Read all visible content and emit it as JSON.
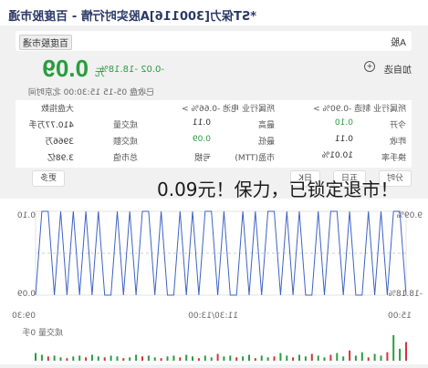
{
  "title": "*ST保力[300116]A股实时行情 - 百度股市通",
  "tabs": {
    "left": "A股",
    "right": "百度股市通"
  },
  "quote": {
    "price": "0.09",
    "unit": "元",
    "change": "-0.02 -18.18%",
    "status": "已收盘  05-15 15:30:00  北京时间"
  },
  "watch": {
    "label": "加自选"
  },
  "industry": {
    "left": "大盘指数",
    "middle": "所属行业 电池 -0.66% >",
    "right": "所属行业 制造 -0.90% >"
  },
  "stats": [
    {
      "label": "今开",
      "value": "0.10",
      "tone": "green"
    },
    {
      "label": "最高",
      "value": "0.11",
      "tone": ""
    },
    {
      "label": "成交量",
      "value": "410.77万手",
      "tone": ""
    },
    {
      "label": "昨收",
      "value": "0.11",
      "tone": ""
    },
    {
      "label": "最低",
      "value": "0.09",
      "tone": "green"
    },
    {
      "label": "成交额",
      "value": "3966万",
      "tone": ""
    },
    {
      "label": "换手率",
      "value": "10.01%",
      "tone": ""
    },
    {
      "label": "市盈(TTM)",
      "value": "亏损",
      "tone": ""
    },
    {
      "label": "总市值",
      "value": "3.98亿",
      "tone": ""
    }
  ],
  "buttons": [
    "分时",
    "五日",
    "日K",
    "更多"
  ],
  "overlay": "0.09元！保力，已锁定退市！",
  "chart_data": {
    "type": "line",
    "title": "",
    "xlabel": "",
    "ylabel": "",
    "x_ticks": [
      "09:30",
      "11:30/13:00",
      "15:00"
    ],
    "y_ticks": [
      "0.10",
      "0.09"
    ],
    "y_ticks_secondary": [
      "9.09%",
      "-18.18%"
    ],
    "ylim": [
      0.09,
      0.1
    ],
    "series": [
      {
        "name": "",
        "values": [
          0.09,
          0.1,
          0.1,
          0.09,
          0.1,
          0.09,
          0.1,
          0.09,
          0.09,
          0.1,
          0.09,
          0.1,
          0.1,
          0.09,
          0.1,
          0.09,
          0.09,
          0.1,
          0.09,
          0.1,
          0.09,
          0.1,
          0.1,
          0.09,
          0.1,
          0.09,
          0.1,
          0.09,
          0.09,
          0.1,
          0.09,
          0.1,
          0.1,
          0.09,
          0.1,
          0.09,
          0.1,
          0.09,
          0.09,
          0.1,
          0.09,
          0.1,
          0.1,
          0.09,
          0.1,
          0.09,
          0.1,
          0.09,
          0.09,
          0.1,
          0.09,
          0.1,
          0.09,
          0.1,
          0.09,
          0.1,
          0.09,
          0.1,
          0.1,
          0.09
        ]
      }
    ],
    "volume_label": "成交量 0手",
    "volume": [
      22,
      14,
      30,
      10,
      6,
      8,
      4,
      10,
      6,
      12,
      5,
      9,
      7,
      4,
      6,
      8,
      5,
      7,
      4,
      6,
      9,
      5,
      4,
      6,
      3,
      7,
      5,
      4,
      6,
      5,
      8,
      4,
      6,
      3,
      5,
      7,
      4,
      6,
      5,
      3,
      4,
      6,
      5,
      7,
      4,
      3,
      5,
      6,
      4,
      5,
      7,
      4,
      6,
      5,
      3,
      4,
      6,
      5,
      7,
      9
    ],
    "colors": {
      "line": "#3e62c5",
      "base": "#cccccc",
      "up": "#d4333c",
      "down": "#2a9d3f"
    }
  }
}
